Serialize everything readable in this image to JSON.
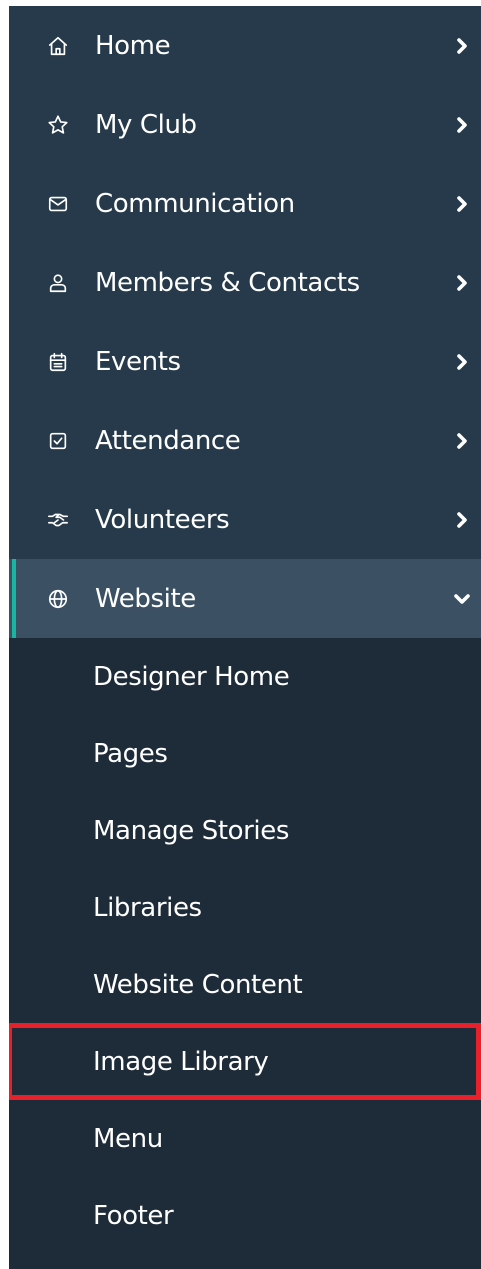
{
  "nav": {
    "items": [
      {
        "label": "Home",
        "icon": "home-icon"
      },
      {
        "label": "My Club",
        "icon": "star-icon"
      },
      {
        "label": "Communication",
        "icon": "envelope-icon"
      },
      {
        "label": "Members & Contacts",
        "icon": "person-icon"
      },
      {
        "label": "Events",
        "icon": "calendar-icon"
      },
      {
        "label": "Attendance",
        "icon": "checkbox-icon"
      },
      {
        "label": "Volunteers",
        "icon": "handshake-icon"
      }
    ],
    "active": {
      "label": "Website",
      "icon": "globe-icon",
      "expanded": true
    },
    "subitems": [
      {
        "label": "Designer Home"
      },
      {
        "label": "Pages"
      },
      {
        "label": "Manage Stories"
      },
      {
        "label": "Libraries"
      },
      {
        "label": "Website Content"
      },
      {
        "label": "Image Library",
        "highlighted": true
      },
      {
        "label": "Menu"
      },
      {
        "label": "Footer"
      }
    ]
  },
  "colors": {
    "sidebar_bg": "#263a4b",
    "submenu_bg": "#1e2b38",
    "active_bg": "#3b5163",
    "active_accent": "#19b5a0",
    "highlight_border": "#e8202a",
    "text": "#ffffff"
  }
}
